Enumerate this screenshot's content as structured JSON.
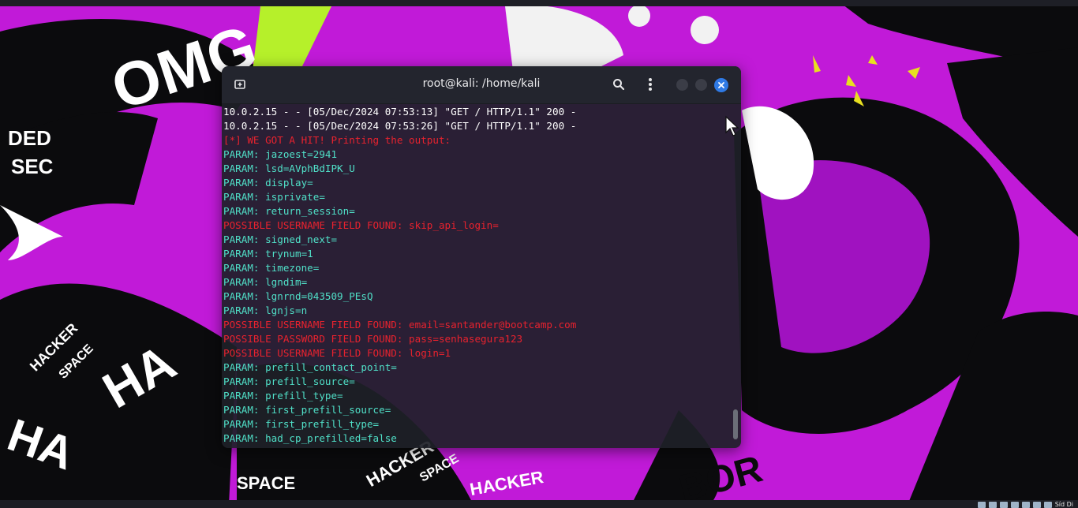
{
  "terminal": {
    "title": "root@kali: /home/kali",
    "lines": [
      {
        "text": "10.0.2.15 - - [05/Dec/2024 07:53:13] \"GET / HTTP/1.1\" 200 -",
        "color": "white"
      },
      {
        "text": "10.0.2.15 - - [05/Dec/2024 07:53:26] \"GET / HTTP/1.1\" 200 -",
        "color": "white"
      },
      {
        "text": "[*] WE GOT A HIT! Printing the output:",
        "color": "red"
      },
      {
        "text": "PARAM: jazoest=2941",
        "color": "teal"
      },
      {
        "text": "PARAM: lsd=AVphBdIPK_U",
        "color": "teal"
      },
      {
        "text": "PARAM: display=",
        "color": "teal"
      },
      {
        "text": "PARAM: isprivate=",
        "color": "teal"
      },
      {
        "text": "PARAM: return_session=",
        "color": "teal"
      },
      {
        "text": "POSSIBLE USERNAME FIELD FOUND: skip_api_login=",
        "color": "red"
      },
      {
        "text": "PARAM: signed_next=",
        "color": "teal"
      },
      {
        "text": "PARAM: trynum=1",
        "color": "teal"
      },
      {
        "text": "PARAM: timezone=",
        "color": "teal"
      },
      {
        "text": "PARAM: lgndim=",
        "color": "teal"
      },
      {
        "text": "PARAM: lgnrnd=043509_PEsQ",
        "color": "teal"
      },
      {
        "text": "PARAM: lgnjs=n",
        "color": "teal"
      },
      {
        "text": "POSSIBLE USERNAME FIELD FOUND: email=santander@bootcamp.com",
        "color": "red"
      },
      {
        "text": "POSSIBLE PASSWORD FIELD FOUND: pass=senhasegura123",
        "color": "red"
      },
      {
        "text": "POSSIBLE USERNAME FIELD FOUND: login=1",
        "color": "red"
      },
      {
        "text": "PARAM: prefill_contact_point=",
        "color": "teal"
      },
      {
        "text": "PARAM: prefill_source=",
        "color": "teal"
      },
      {
        "text": "PARAM: prefill_type=",
        "color": "teal"
      },
      {
        "text": "PARAM: first_prefill_source=",
        "color": "teal"
      },
      {
        "text": "PARAM: first_prefill_type=",
        "color": "teal"
      },
      {
        "text": "PARAM: had_cp_prefilled=false",
        "color": "teal"
      }
    ]
  },
  "wallpaper": {
    "texts": [
      "OMG",
      "DED",
      "SEC",
      "HACKER",
      "SPACE",
      "HACKER",
      "SPACE",
      "HACKER",
      "HA",
      "HA",
      "SPACE",
      "BOR"
    ]
  },
  "taskbar": {
    "tray_label": "Síd Di"
  },
  "colors": {
    "accent": "#2f7ae5",
    "error": "#e8222e",
    "param": "#50e0c8",
    "wallpaper": "#c11ad8"
  }
}
